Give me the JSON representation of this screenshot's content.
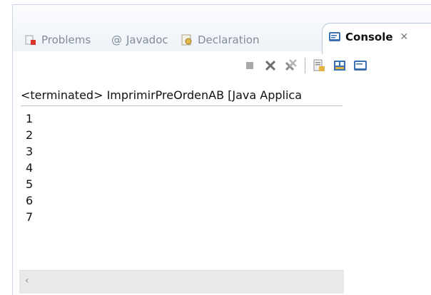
{
  "tabs": [
    {
      "label": "Problems",
      "icon": "problems-icon"
    },
    {
      "label": "Javadoc",
      "icon": "javadoc-icon"
    },
    {
      "label": "Declaration",
      "icon": "declaration-icon"
    }
  ],
  "active_tab": {
    "label": "Console",
    "icon": "console-icon",
    "close_icon": "close-icon",
    "close_glyph": "✕"
  },
  "toolbar": {
    "buttons": [
      "terminate-icon",
      "remove-launch-icon",
      "remove-all-terminated-icon",
      "scroll-lock-icon",
      "show-console-icon",
      "display-selected-console-icon"
    ]
  },
  "console": {
    "header": "<terminated> ImprimirPreOrdenAB [Java Applica",
    "lines": [
      "1",
      "2",
      "3",
      "4",
      "5",
      "6",
      "7"
    ]
  },
  "scrollbar": {
    "left_arrow": "‹"
  },
  "colors": {
    "accent": "#3a6fb0",
    "tab_border": "#b8c7d9",
    "text": "#111111",
    "inactive_text": "#7f8c99"
  }
}
